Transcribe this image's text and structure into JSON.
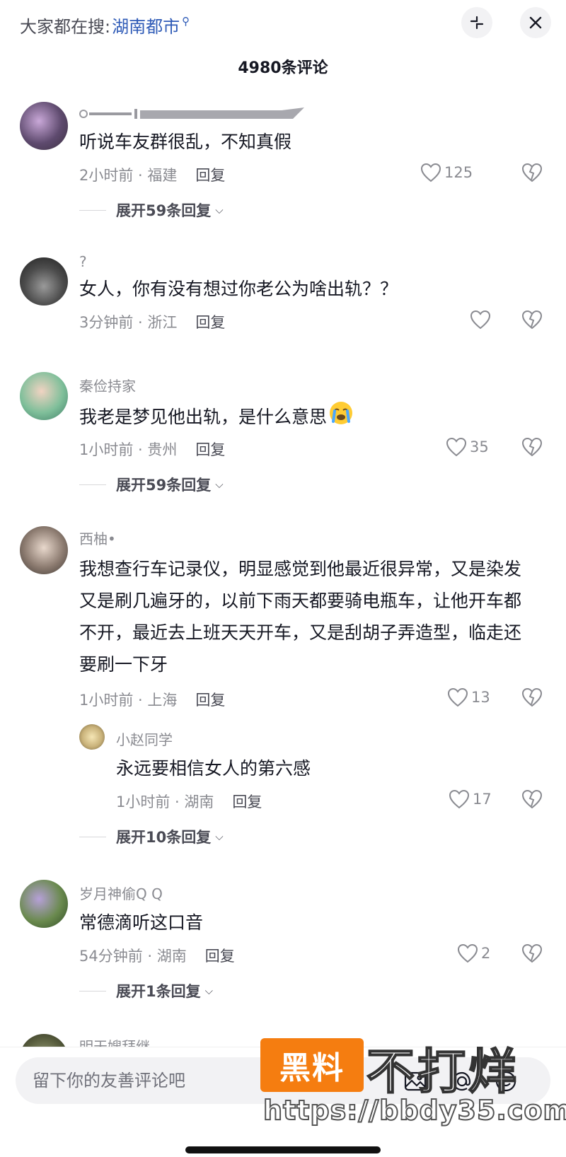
{
  "header": {
    "search_prefix": "大家都在搜:",
    "search_keyword": "湖南都市",
    "comment_count_title": "4980条评论"
  },
  "comments": [
    {
      "username": "",
      "text": "听说车友群很乱，不知真假",
      "time_location": "2小时前 · 福建",
      "reply_label": "回复",
      "likes": "125",
      "expand_label": "展开59条回复"
    },
    {
      "username": "?",
      "text": "女人，你有没有想过你老公为啥出轨？？",
      "time_location": "3分钟前 · 浙江",
      "reply_label": "回复",
      "likes": ""
    },
    {
      "username": "秦俭持家",
      "text": "我老是梦见他出轨，是什么意思",
      "time_location": "1小时前 · 贵州",
      "reply_label": "回复",
      "likes": "35",
      "expand_label": "展开59条回复"
    },
    {
      "username": "西柚•",
      "text": "我想查行车记录仪，明显感觉到他最近很异常，又是染发又是刷几遍牙的，以前下雨天都要骑电瓶车，让他开车都不开，最近去上班天天开车，又是刮胡子弄造型，临走还要刷一下牙",
      "time_location": "1小时前 · 上海",
      "reply_label": "回复",
      "likes": "13",
      "reply": {
        "username": "小赵同学",
        "text": "永远要相信女人的第六感",
        "time_location": "1小时前 · 湖南",
        "reply_label": "回复",
        "likes": "17"
      },
      "expand_label": "展开10条回复"
    },
    {
      "username": "岁月神偷Q Q",
      "text": "常德滴听这口音",
      "time_location": "54分钟前 · 湖南",
      "reply_label": "回复",
      "likes": "2",
      "expand_label": "展开1条回复"
    },
    {
      "username": "明天嫂拜继",
      "text": ""
    }
  ],
  "bottom_bar": {
    "input_placeholder": "留下你的友善评论吧",
    "icons": [
      "image-icon",
      "at-icon",
      "emoji-icon"
    ]
  },
  "watermark": {
    "badge": "黑料",
    "text": "不打烊",
    "url": "https://bbdy35.com"
  },
  "colors": {
    "keyword_blue": "#2f5bb7",
    "secondary_gray": "#8a8b91",
    "watermark_orange": "#f57d10"
  }
}
